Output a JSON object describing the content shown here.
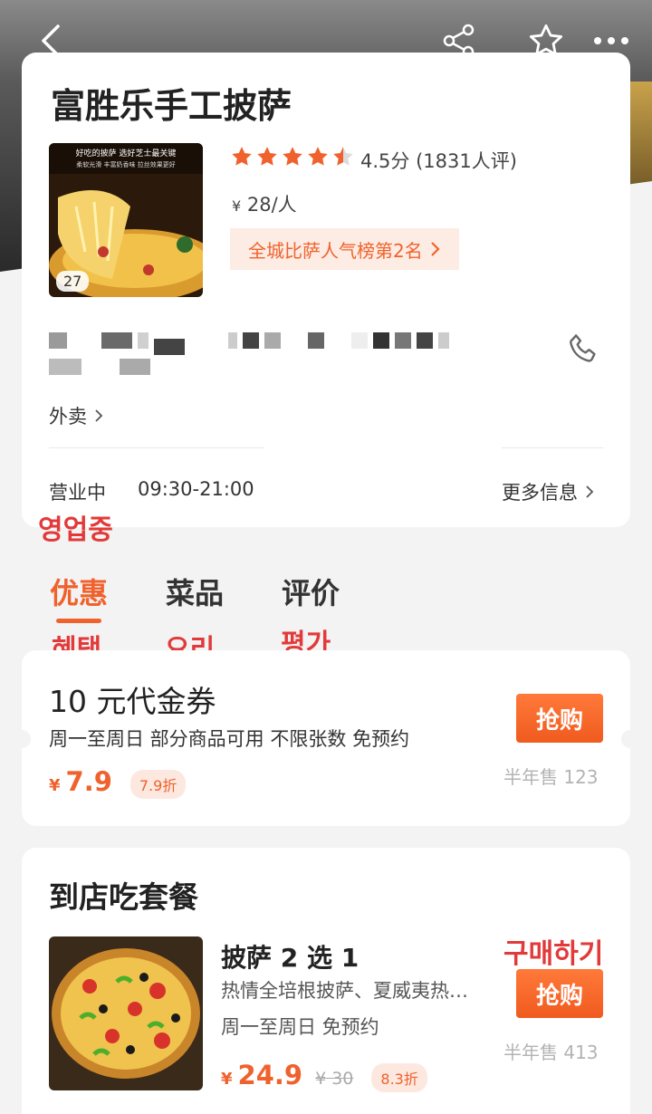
{
  "header": {
    "back_icon": "back-icon",
    "share_icon": "share-icon",
    "favorite_icon": "star-icon",
    "more_icon": "more-icon"
  },
  "shop": {
    "name": "富胜乐手工披萨",
    "photo_count": "27",
    "rating_stars": 4.5,
    "rating_text": "4.5分 (1831人评)",
    "price_yen": "¥",
    "price_value": "28/人",
    "rank_label": "全城比萨人气榜第2名",
    "delivery_label": "外卖",
    "status": "营业中",
    "hours": "09:30-21:00",
    "more_info_label": "更多信息"
  },
  "annotations": {
    "status_ko": "영업중",
    "tab1_ko": "혜택",
    "tab2_ko": "요리",
    "tab3_ko": "평가",
    "buy_ko": "구매하기"
  },
  "tabs": [
    {
      "label": "优惠",
      "active": true
    },
    {
      "label": "菜品",
      "active": false
    },
    {
      "label": "评价",
      "active": false
    }
  ],
  "voucher": {
    "title": "10 元代金券",
    "description": "周一至周日  部分商品可用  不限张数  免预约",
    "price_yen": "¥",
    "price": "7.9",
    "discount": "7.9折",
    "buy_label": "抢购",
    "sold": "半年售 123"
  },
  "set_meal": {
    "section_title": "到店吃套餐",
    "item_name": "披萨 2 选 1",
    "item_desc": "热情全培根披萨、夏威夷热…",
    "availability": "周一至周日  免预约",
    "price_yen": "¥",
    "price": "24.9",
    "old_price": "¥ 30",
    "discount": "8.3折",
    "buy_label": "抢购",
    "sold": "半年售 413"
  },
  "colors": {
    "accent": "#f0622d",
    "annotation_red": "#e23a3a",
    "star": "#f0622d"
  }
}
